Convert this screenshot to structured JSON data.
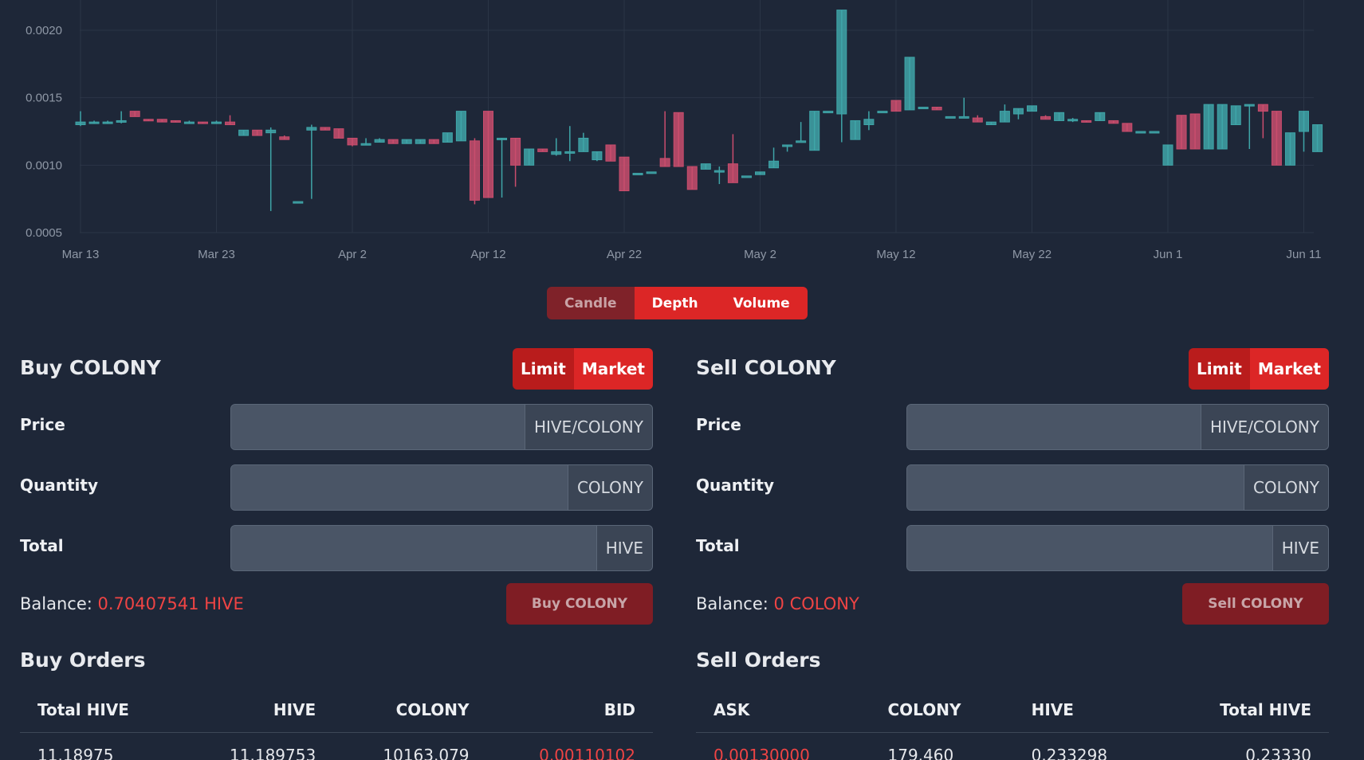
{
  "chart_data": {
    "type": "candlestick",
    "x_ticks": [
      "Mar 13",
      "Mar 23",
      "Apr 2",
      "Apr 12",
      "Apr 22",
      "May 2",
      "May 12",
      "May 22",
      "Jun 1",
      "Jun 11"
    ],
    "y_ticks": [
      "0.0005",
      "0.0010",
      "0.0015",
      "0.0020"
    ],
    "ylim": [
      0.0005,
      0.00215
    ],
    "grid": true,
    "up_color": "#3fa5a8",
    "down_color": "#c94d6d",
    "candles": [
      {
        "day": 0,
        "o": 0.0013,
        "c": 0.00132,
        "h": 0.0014,
        "l": 0.00129
      },
      {
        "day": 1,
        "o": 0.00132,
        "c": 0.00132,
        "h": 0.00133,
        "l": 0.00131
      },
      {
        "day": 2,
        "o": 0.00132,
        "c": 0.00132,
        "h": 0.00133,
        "l": 0.00131
      },
      {
        "day": 3,
        "o": 0.00132,
        "c": 0.00133,
        "h": 0.0014,
        "l": 0.00131
      },
      {
        "day": 4,
        "o": 0.0014,
        "c": 0.00136,
        "h": 0.0014,
        "l": 0.00136
      },
      {
        "day": 5,
        "o": 0.00134,
        "c": 0.00133,
        "h": 0.00134,
        "l": 0.00133
      },
      {
        "day": 6,
        "o": 0.00134,
        "c": 0.00132,
        "h": 0.00134,
        "l": 0.00132
      },
      {
        "day": 7,
        "o": 0.00133,
        "c": 0.00132,
        "h": 0.00133,
        "l": 0.00132
      },
      {
        "day": 8,
        "o": 0.00132,
        "c": 0.00132,
        "h": 0.00133,
        "l": 0.00131
      },
      {
        "day": 9,
        "o": 0.00132,
        "c": 0.00131,
        "h": 0.00132,
        "l": 0.00131
      },
      {
        "day": 10,
        "o": 0.00131,
        "c": 0.00132,
        "h": 0.00133,
        "l": 0.00131
      },
      {
        "day": 11,
        "o": 0.00132,
        "c": 0.0013,
        "h": 0.00137,
        "l": 0.0013
      },
      {
        "day": 12,
        "o": 0.00122,
        "c": 0.00126,
        "h": 0.00126,
        "l": 0.00122
      },
      {
        "day": 13,
        "o": 0.00126,
        "c": 0.00122,
        "h": 0.00126,
        "l": 0.00122
      },
      {
        "day": 14,
        "o": 0.00124,
        "c": 0.00126,
        "h": 0.00128,
        "l": 0.00066
      },
      {
        "day": 15,
        "o": 0.00121,
        "c": 0.00119,
        "h": 0.00122,
        "l": 0.00119
      },
      {
        "day": 16,
        "o": 0.00073,
        "c": 0.00073,
        "h": 0.00073,
        "l": 0.00073
      },
      {
        "day": 17,
        "o": 0.00126,
        "c": 0.00128,
        "h": 0.0013,
        "l": 0.00075
      },
      {
        "day": 18,
        "o": 0.00128,
        "c": 0.00126,
        "h": 0.00128,
        "l": 0.00126
      },
      {
        "day": 19,
        "o": 0.00127,
        "c": 0.0012,
        "h": 0.00127,
        "l": 0.0012
      },
      {
        "day": 20,
        "o": 0.0012,
        "c": 0.00115,
        "h": 0.0012,
        "l": 0.00114
      },
      {
        "day": 21,
        "o": 0.00115,
        "c": 0.00116,
        "h": 0.0012,
        "l": 0.00115
      },
      {
        "day": 22,
        "o": 0.00117,
        "c": 0.00119,
        "h": 0.0012,
        "l": 0.00117
      },
      {
        "day": 23,
        "o": 0.00119,
        "c": 0.00116,
        "h": 0.00119,
        "l": 0.00116
      },
      {
        "day": 24,
        "o": 0.00116,
        "c": 0.00119,
        "h": 0.00119,
        "l": 0.00116
      },
      {
        "day": 25,
        "o": 0.00116,
        "c": 0.00119,
        "h": 0.00119,
        "l": 0.00116
      },
      {
        "day": 26,
        "o": 0.00119,
        "c": 0.00116,
        "h": 0.00119,
        "l": 0.00116
      },
      {
        "day": 27,
        "o": 0.00117,
        "c": 0.00124,
        "h": 0.00124,
        "l": 0.00117
      },
      {
        "day": 28,
        "o": 0.00118,
        "c": 0.0014,
        "h": 0.0014,
        "l": 0.00118
      },
      {
        "day": 29,
        "o": 0.00118,
        "c": 0.00074,
        "h": 0.0012,
        "l": 0.00071
      },
      {
        "day": 30,
        "o": 0.0014,
        "c": 0.00076,
        "h": 0.0014,
        "l": 0.00076
      },
      {
        "day": 31,
        "o": 0.0012,
        "c": 0.0012,
        "h": 0.0012,
        "l": 0.00076
      },
      {
        "day": 32,
        "o": 0.0012,
        "c": 0.001,
        "h": 0.0012,
        "l": 0.00084
      },
      {
        "day": 33,
        "o": 0.001,
        "c": 0.00112,
        "h": 0.00112,
        "l": 0.001
      },
      {
        "day": 34,
        "o": 0.00112,
        "c": 0.0011,
        "h": 0.00112,
        "l": 0.0011
      },
      {
        "day": 35,
        "o": 0.00108,
        "c": 0.0011,
        "h": 0.0012,
        "l": 0.00107
      },
      {
        "day": 36,
        "o": 0.0011,
        "c": 0.0011,
        "h": 0.00129,
        "l": 0.00103
      },
      {
        "day": 37,
        "o": 0.0011,
        "c": 0.0012,
        "h": 0.00124,
        "l": 0.0011
      },
      {
        "day": 38,
        "o": 0.00104,
        "c": 0.0011,
        "h": 0.0011,
        "l": 0.00103
      },
      {
        "day": 39,
        "o": 0.00115,
        "c": 0.00103,
        "h": 0.00115,
        "l": 0.00103
      },
      {
        "day": 40,
        "o": 0.00106,
        "c": 0.00081,
        "h": 0.00106,
        "l": 0.00081
      },
      {
        "day": 41,
        "o": 0.00094,
        "c": 0.00094,
        "h": 0.00094,
        "l": 0.00094
      },
      {
        "day": 42,
        "o": 0.00095,
        "c": 0.00095,
        "h": 0.00095,
        "l": 0.00095
      },
      {
        "day": 43,
        "o": 0.00105,
        "c": 0.00099,
        "h": 0.0014,
        "l": 0.00099
      },
      {
        "day": 44,
        "o": 0.00139,
        "c": 0.00099,
        "h": 0.00139,
        "l": 0.00099
      },
      {
        "day": 45,
        "o": 0.00099,
        "c": 0.00082,
        "h": 0.00099,
        "l": 0.00082
      },
      {
        "day": 46,
        "o": 0.00097,
        "c": 0.00101,
        "h": 0.00101,
        "l": 0.00097
      },
      {
        "day": 47,
        "o": 0.00096,
        "c": 0.00096,
        "h": 0.00099,
        "l": 0.00086
      },
      {
        "day": 48,
        "o": 0.00101,
        "c": 0.00087,
        "h": 0.00123,
        "l": 0.00087
      },
      {
        "day": 49,
        "o": 0.00092,
        "c": 0.00092,
        "h": 0.00092,
        "l": 0.00092
      },
      {
        "day": 50,
        "o": 0.00093,
        "c": 0.00095,
        "h": 0.00095,
        "l": 0.00093
      },
      {
        "day": 51,
        "o": 0.00098,
        "c": 0.00103,
        "h": 0.00113,
        "l": 0.00098
      },
      {
        "day": 52,
        "o": 0.00114,
        "c": 0.00115,
        "h": 0.00115,
        "l": 0.0011
      },
      {
        "day": 53,
        "o": 0.00118,
        "c": 0.00118,
        "h": 0.00132,
        "l": 0.00118
      },
      {
        "day": 54,
        "o": 0.00111,
        "c": 0.0014,
        "h": 0.0014,
        "l": 0.00111
      },
      {
        "day": 55,
        "o": 0.0014,
        "c": 0.0014,
        "h": 0.0014,
        "l": 0.0014
      },
      {
        "day": 56,
        "o": 0.00138,
        "c": 0.00215,
        "h": 0.00215,
        "l": 0.00117
      },
      {
        "day": 57,
        "o": 0.00119,
        "c": 0.00133,
        "h": 0.00133,
        "l": 0.00119
      },
      {
        "day": 58,
        "o": 0.0013,
        "c": 0.00134,
        "h": 0.0014,
        "l": 0.00126
      },
      {
        "day": 59,
        "o": 0.0014,
        "c": 0.0014,
        "h": 0.0014,
        "l": 0.0014
      },
      {
        "day": 60,
        "o": 0.00148,
        "c": 0.0014,
        "h": 0.00148,
        "l": 0.0014
      },
      {
        "day": 61,
        "o": 0.00141,
        "c": 0.0018,
        "h": 0.0018,
        "l": 0.00141
      },
      {
        "day": 62,
        "o": 0.00143,
        "c": 0.00143,
        "h": 0.00143,
        "l": 0.00143
      },
      {
        "day": 63,
        "o": 0.00143,
        "c": 0.00141,
        "h": 0.00143,
        "l": 0.00141
      },
      {
        "day": 64,
        "o": 0.00136,
        "c": 0.00136,
        "h": 0.00136,
        "l": 0.00136
      },
      {
        "day": 65,
        "o": 0.00136,
        "c": 0.00136,
        "h": 0.0015,
        "l": 0.00136
      },
      {
        "day": 66,
        "o": 0.00135,
        "c": 0.00132,
        "h": 0.00137,
        "l": 0.00132
      },
      {
        "day": 67,
        "o": 0.0013,
        "c": 0.00132,
        "h": 0.00132,
        "l": 0.0013
      },
      {
        "day": 68,
        "o": 0.00132,
        "c": 0.0014,
        "h": 0.00145,
        "l": 0.00132
      },
      {
        "day": 69,
        "o": 0.00138,
        "c": 0.00142,
        "h": 0.00142,
        "l": 0.00134
      },
      {
        "day": 70,
        "o": 0.0014,
        "c": 0.00144,
        "h": 0.00144,
        "l": 0.0014
      },
      {
        "day": 71,
        "o": 0.00136,
        "c": 0.00134,
        "h": 0.00137,
        "l": 0.00134
      },
      {
        "day": 72,
        "o": 0.00133,
        "c": 0.00139,
        "h": 0.00139,
        "l": 0.00133
      },
      {
        "day": 73,
        "o": 0.00133,
        "c": 0.00134,
        "h": 0.00135,
        "l": 0.00132
      },
      {
        "day": 74,
        "o": 0.00133,
        "c": 0.00132,
        "h": 0.00133,
        "l": 0.00132
      },
      {
        "day": 75,
        "o": 0.00133,
        "c": 0.00139,
        "h": 0.00139,
        "l": 0.00133
      },
      {
        "day": 76,
        "o": 0.00133,
        "c": 0.00131,
        "h": 0.00133,
        "l": 0.00131
      },
      {
        "day": 77,
        "o": 0.00131,
        "c": 0.00125,
        "h": 0.00131,
        "l": 0.00125
      },
      {
        "day": 78,
        "o": 0.00125,
        "c": 0.00125,
        "h": 0.00125,
        "l": 0.00125
      },
      {
        "day": 79,
        "o": 0.00125,
        "c": 0.00125,
        "h": 0.00125,
        "l": 0.00125
      },
      {
        "day": 80,
        "o": 0.001,
        "c": 0.00115,
        "h": 0.00115,
        "l": 0.001
      },
      {
        "day": 81,
        "o": 0.00137,
        "c": 0.00112,
        "h": 0.00137,
        "l": 0.00112
      },
      {
        "day": 82,
        "o": 0.00138,
        "c": 0.00112,
        "h": 0.00138,
        "l": 0.00112
      },
      {
        "day": 83,
        "o": 0.00112,
        "c": 0.00145,
        "h": 0.00145,
        "l": 0.00112
      },
      {
        "day": 84,
        "o": 0.00112,
        "c": 0.00145,
        "h": 0.00145,
        "l": 0.00112
      },
      {
        "day": 85,
        "o": 0.0013,
        "c": 0.00144,
        "h": 0.00144,
        "l": 0.0013
      },
      {
        "day": 86,
        "o": 0.00145,
        "c": 0.00145,
        "h": 0.00145,
        "l": 0.00112
      },
      {
        "day": 87,
        "o": 0.00145,
        "c": 0.0014,
        "h": 0.00145,
        "l": 0.0012
      },
      {
        "day": 88,
        "o": 0.0014,
        "c": 0.001,
        "h": 0.0014,
        "l": 0.001
      },
      {
        "day": 89,
        "o": 0.001,
        "c": 0.00124,
        "h": 0.00124,
        "l": 0.001
      },
      {
        "day": 90,
        "o": 0.00125,
        "c": 0.0014,
        "h": 0.0014,
        "l": 0.0011
      },
      {
        "day": 91,
        "o": 0.0011,
        "c": 0.0013,
        "h": 0.0013,
        "l": 0.0011
      }
    ]
  },
  "chart_toggle": {
    "candle": "Candle",
    "depth": "Depth",
    "volume": "Volume"
  },
  "buy": {
    "title": "Buy COLONY",
    "limit_label": "Limit",
    "market_label": "Market",
    "price_label": "Price",
    "price_unit": "HIVE/COLONY",
    "quantity_label": "Quantity",
    "quantity_unit": "COLONY",
    "total_label": "Total",
    "total_unit": "HIVE",
    "balance_label": "Balance:",
    "balance_value": "0.70407541 HIVE",
    "action_label": "Buy COLONY",
    "orders_title": "Buy Orders",
    "orders_headers": [
      "Total HIVE",
      "HIVE",
      "COLONY",
      "BID"
    ],
    "orders_rows": [
      [
        "11.18975",
        "11.189753",
        "10163.079",
        "0.00110102"
      ]
    ]
  },
  "sell": {
    "title": "Sell COLONY",
    "limit_label": "Limit",
    "market_label": "Market",
    "price_label": "Price",
    "price_unit": "HIVE/COLONY",
    "quantity_label": "Quantity",
    "quantity_unit": "COLONY",
    "total_label": "Total",
    "total_unit": "HIVE",
    "balance_label": "Balance:",
    "balance_value": "0 COLONY",
    "action_label": "Sell COLONY",
    "orders_title": "Sell Orders",
    "orders_headers": [
      "ASK",
      "COLONY",
      "HIVE",
      "Total HIVE"
    ],
    "orders_rows": [
      [
        "0.00130000",
        "179.460",
        "0.233298",
        "0.23330"
      ]
    ]
  }
}
